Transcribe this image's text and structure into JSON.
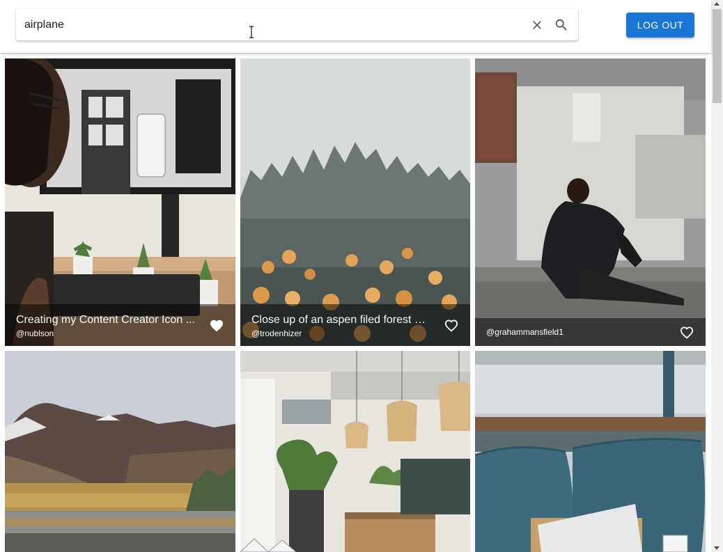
{
  "search": {
    "value": "airplane",
    "clear_icon": "close-icon",
    "search_icon": "search-icon"
  },
  "header": {
    "logout_label": "LOG OUT"
  },
  "photos": [
    {
      "title": "Creating my Content Creator Icon ...",
      "user": "@nublson",
      "liked": true
    },
    {
      "title": "Close up of an aspen filed forest wi...",
      "user": "@trodenhizer",
      "liked": false
    },
    {
      "title": "",
      "user": "@grahammansfield1",
      "liked": false
    },
    {
      "title": "",
      "user": "",
      "liked": false
    },
    {
      "title": "",
      "user": "",
      "liked": false
    },
    {
      "title": "",
      "user": "",
      "liked": false
    }
  ],
  "colors": {
    "accent": "#1976d2",
    "caption_overlay": "rgba(0,0,0,0.5)"
  }
}
